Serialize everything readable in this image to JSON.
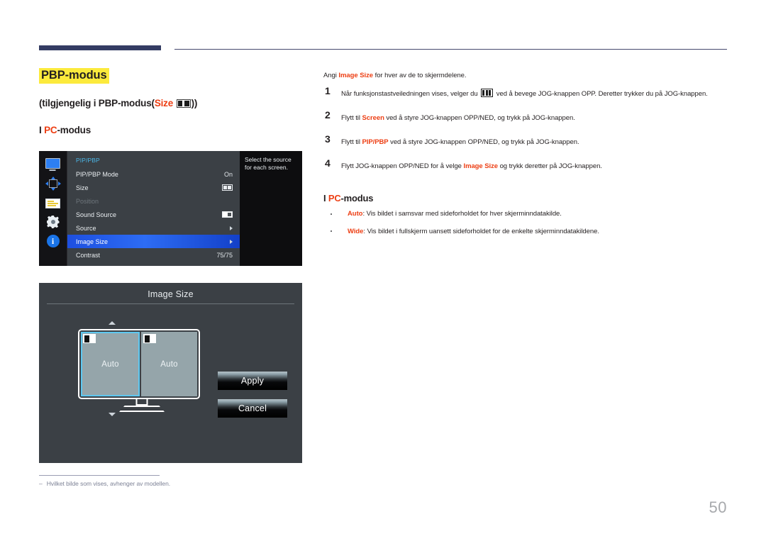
{
  "header": {
    "accent_color": "#343c63"
  },
  "left": {
    "title": "PBP-modus",
    "title_highlight_color": "#fcea3c",
    "availability_prefix": "(tilgjengelig i PBP-modus(",
    "availability_size_label": "Size",
    "availability_suffix": "))",
    "pc_mode_bar": "I",
    "pc_mode_red": "PC",
    "pc_mode_rest": "-modus",
    "footnote_dash": "‒",
    "footnote": "Hvilket bilde som vises, avhenger av modellen."
  },
  "osd": {
    "rail_icons": [
      "display-icon",
      "pip-pbp-move-icon",
      "onscreen-display-icon",
      "system-gear-icon",
      "information-icon"
    ],
    "info_glyph": "i",
    "category": "PIP/PBP",
    "rows": [
      {
        "label": "PIP/PBP Mode",
        "value": "On",
        "value_kind": "text",
        "state": "normal"
      },
      {
        "label": "Size",
        "value": "",
        "value_kind": "pbp-icon",
        "state": "normal"
      },
      {
        "label": "Position",
        "value": "",
        "value_kind": "none",
        "state": "disabled"
      },
      {
        "label": "Sound Source",
        "value": "",
        "value_kind": "sound-icon",
        "state": "normal"
      },
      {
        "label": "Source",
        "value": "",
        "value_kind": "arrow",
        "state": "normal"
      },
      {
        "label": "Image Size",
        "value": "",
        "value_kind": "arrow",
        "state": "selected"
      },
      {
        "label": "Contrast",
        "value": "75/75",
        "value_kind": "text",
        "state": "normal"
      }
    ],
    "help_text": "Select the source for each screen.",
    "highlight_color": "#2d6cf4"
  },
  "dialog": {
    "title": "Image Size",
    "pane_left_label": "Auto",
    "pane_right_label": "Auto",
    "selected_pane": "left",
    "selection_color": "#5ec8f0",
    "apply_label": "Apply",
    "cancel_label": "Cancel"
  },
  "right": {
    "intro_before": "Angi ",
    "intro_highlight": "Image Size",
    "intro_after": " for hver av de to skjermdelene.",
    "steps": [
      {
        "num": "1",
        "before": "Når funksjonstastveiledningen vises, velger du ",
        "icon": "menu-three-bars-icon",
        "after": " ved å bevege JOG-knappen OPP. Deretter trykker du på JOG-knappen."
      },
      {
        "num": "2",
        "before": "Flytt til ",
        "highlight": "Screen",
        "after": " ved å styre JOG-knappen OPP/NED, og trykk på JOG-knappen."
      },
      {
        "num": "3",
        "before": "Flytt til ",
        "highlight": "PIP/PBP",
        "after": " ved å styre JOG-knappen OPP/NED, og trykk på JOG-knappen."
      },
      {
        "num": "4",
        "before": "Flytt JOG-knappen OPP/NED for å velge ",
        "highlight": "Image Size",
        "after": " og trykk deretter på JOG-knappen."
      }
    ],
    "pc_mode_bar": "I",
    "pc_mode_red": "PC",
    "pc_mode_rest": "-modus",
    "bullets": [
      {
        "term": "Auto",
        "text": ": Vis bildet i samsvar med sideforholdet for hver skjerminndatakilde."
      },
      {
        "term": "Wide",
        "text": ": Vis bildet i fullskjerm uansett sideforholdet for de enkelte skjerminndatakildene."
      }
    ]
  },
  "page_number": "50"
}
